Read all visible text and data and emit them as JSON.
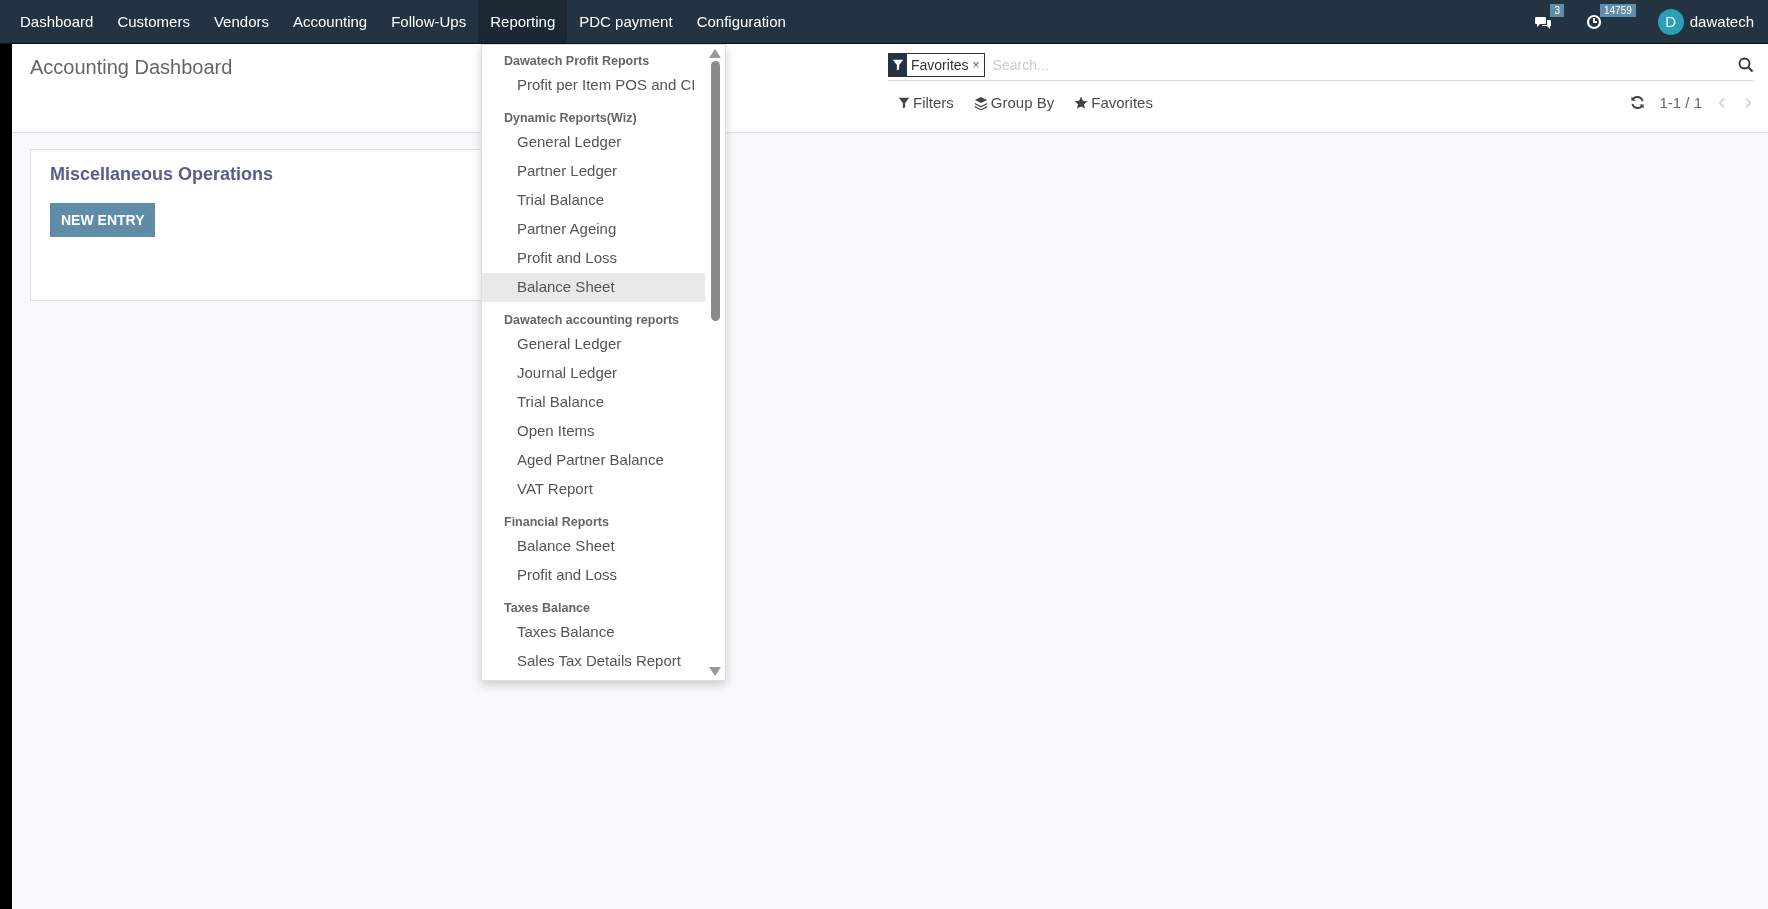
{
  "navbar": {
    "menus": [
      {
        "label": "Dashboard",
        "selected": false
      },
      {
        "label": "Customers",
        "selected": false
      },
      {
        "label": "Vendors",
        "selected": false
      },
      {
        "label": "Accounting",
        "selected": false
      },
      {
        "label": "Follow-Ups",
        "selected": false
      },
      {
        "label": "Reporting",
        "selected": true
      },
      {
        "label": "PDC payment",
        "selected": false
      },
      {
        "label": "Configuration",
        "selected": false
      }
    ],
    "messages_count": "3",
    "activities_count": "14759",
    "user": {
      "initial": "D",
      "name": "dawatech"
    }
  },
  "control_panel": {
    "title": "Accounting Dashboard",
    "search": {
      "facet": "Favorites",
      "remove": "×",
      "placeholder": "Search..."
    },
    "filters": "Filters",
    "group_by": "Group By",
    "favorites": "Favorites",
    "pager": "1-1 / 1"
  },
  "card": {
    "title": "Miscellaneous Operations",
    "button": "NEW ENTRY"
  },
  "reporting_menu": {
    "sections": [
      {
        "header": "Dawatech Profit Reports",
        "items": [
          {
            "label": "Profit per Item POS and CI",
            "selected": false
          }
        ]
      },
      {
        "header": "Dynamic Reports(Wiz)",
        "items": [
          {
            "label": "General Ledger",
            "selected": false
          },
          {
            "label": "Partner Ledger",
            "selected": false
          },
          {
            "label": "Trial Balance",
            "selected": false
          },
          {
            "label": "Partner Ageing",
            "selected": false
          },
          {
            "label": "Profit and Loss",
            "selected": false
          },
          {
            "label": "Balance Sheet",
            "selected": true
          }
        ]
      },
      {
        "header": "Dawatech accounting reports",
        "items": [
          {
            "label": "General Ledger",
            "selected": false
          },
          {
            "label": "Journal Ledger",
            "selected": false
          },
          {
            "label": "Trial Balance",
            "selected": false
          },
          {
            "label": "Open Items",
            "selected": false
          },
          {
            "label": "Aged Partner Balance",
            "selected": false
          },
          {
            "label": "VAT Report",
            "selected": false
          }
        ]
      },
      {
        "header": "Financial Reports",
        "items": [
          {
            "label": "Balance Sheet",
            "selected": false
          },
          {
            "label": "Profit and Loss",
            "selected": false
          }
        ]
      },
      {
        "header": "Taxes Balance",
        "items": [
          {
            "label": "Taxes Balance",
            "selected": false
          },
          {
            "label": "Sales Tax Details Report",
            "selected": false
          }
        ]
      }
    ]
  }
}
